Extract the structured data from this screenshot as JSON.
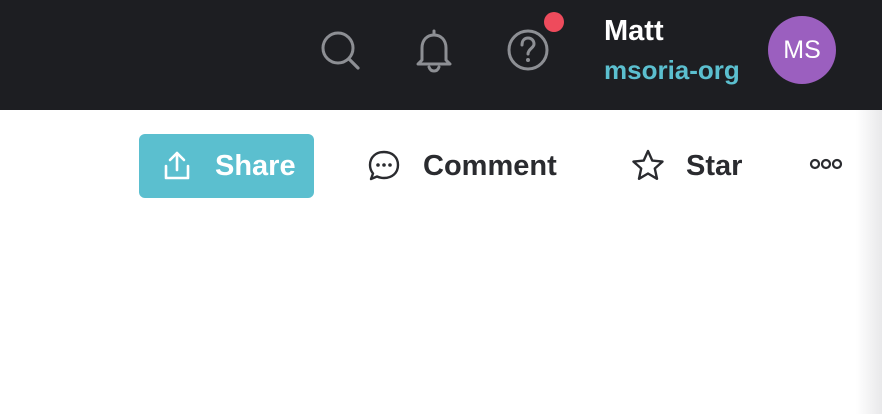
{
  "header": {
    "icons": [
      "search-icon",
      "bell-icon",
      "help-icon"
    ],
    "notification_color": "#ee4b5c",
    "user": {
      "name": "Matt",
      "org": "msoria-org",
      "initials": "MS",
      "avatar_color": "#9b5fbf"
    }
  },
  "toolbar": {
    "share_label": "Share",
    "comment_label": "Comment",
    "star_label": "Star",
    "share_color": "#5bbfcf",
    "more_icon": "more-horizontal-icon"
  }
}
